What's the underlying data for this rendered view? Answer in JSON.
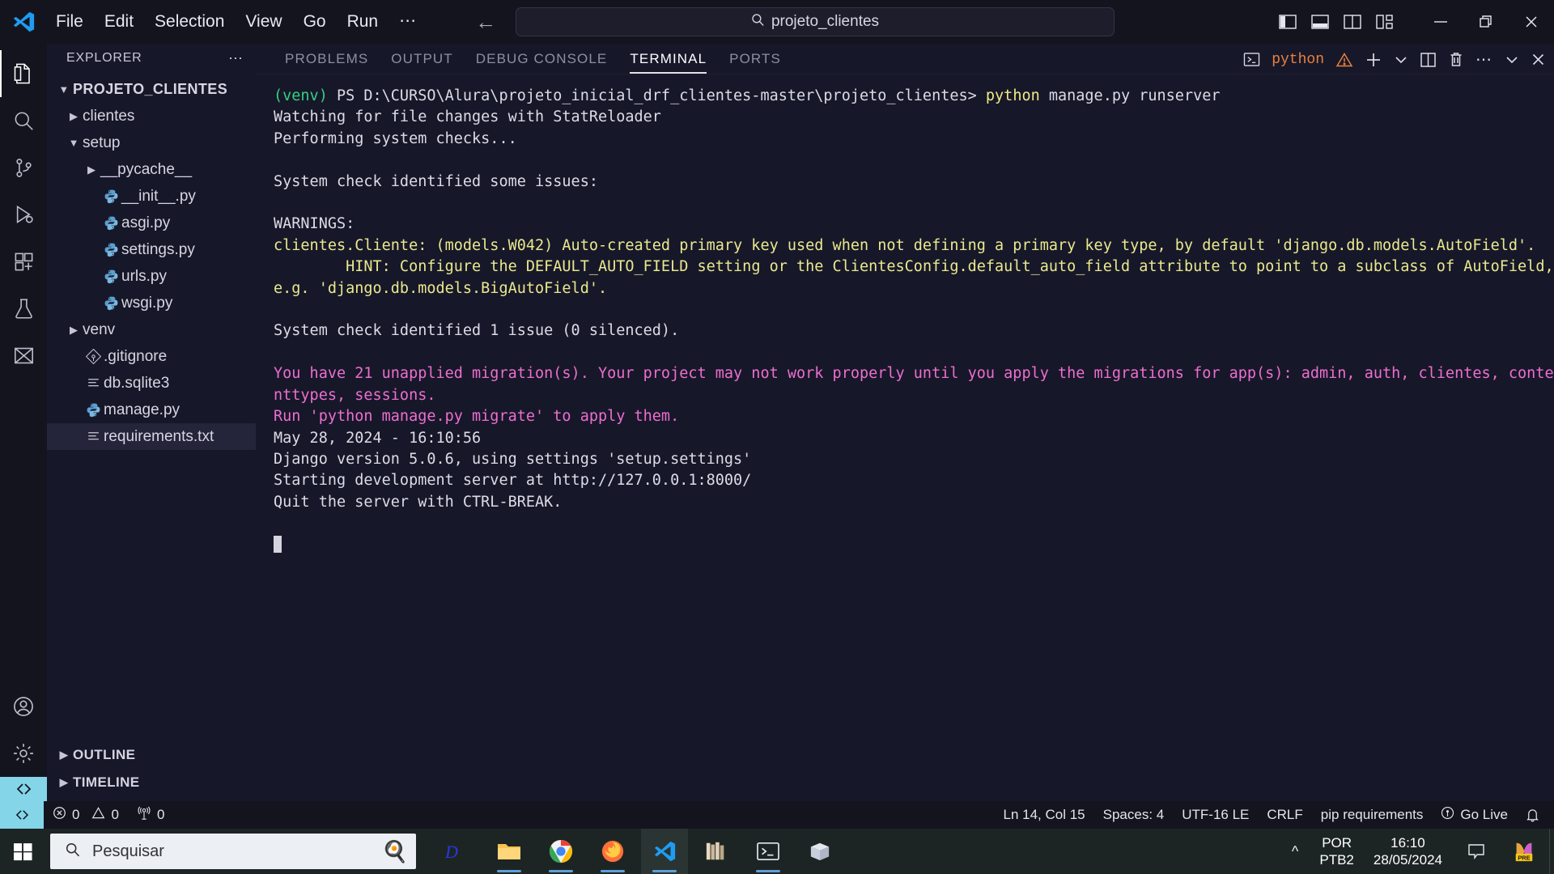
{
  "titlebar": {
    "logo_icon": "vscode-logo-icon",
    "menus": [
      "File",
      "Edit",
      "Selection",
      "View",
      "Go",
      "Run",
      "⋯"
    ],
    "nav": {
      "back_icon": "arrow-left-icon",
      "forward_icon": "arrow-right-icon"
    },
    "search": {
      "icon": "search-icon",
      "value": "projeto_clientes",
      "placeholder": "Search"
    },
    "layout_toggles": [
      "toggle-primary-sidebar-icon",
      "toggle-panel-icon",
      "toggle-secondary-sidebar-icon",
      "customize-layout-icon"
    ],
    "window_controls": {
      "minimize": "minimize-icon",
      "restore": "restore-icon",
      "close": "close-icon"
    }
  },
  "activitybar": {
    "items": [
      {
        "name": "explorer",
        "icon": "files-icon",
        "active": true
      },
      {
        "name": "search",
        "icon": "search-icon",
        "active": false
      },
      {
        "name": "source-control",
        "icon": "source-control-icon",
        "active": false
      },
      {
        "name": "run-and-debug",
        "icon": "run-debug-icon",
        "active": false
      },
      {
        "name": "extensions",
        "icon": "extensions-icon",
        "active": false
      },
      {
        "name": "testing",
        "icon": "beaker-icon",
        "active": false
      },
      {
        "name": "todo",
        "icon": "todo-tree-icon",
        "active": false
      }
    ],
    "bottom": [
      {
        "name": "accounts",
        "icon": "account-icon"
      },
      {
        "name": "manage",
        "icon": "gear-icon"
      }
    ],
    "remote_icon": "remote-window-icon"
  },
  "sidebar": {
    "title": "EXPLORER",
    "more_icon": "more-actions-icon",
    "root": {
      "label": "PROJETO_CLIENTES",
      "expanded": true
    },
    "tree": [
      {
        "label": "clientes",
        "type": "folder",
        "expanded": false,
        "indent": 1,
        "icon": "chevron-right-icon"
      },
      {
        "label": "setup",
        "type": "folder",
        "expanded": true,
        "indent": 1,
        "icon": "chevron-down-icon"
      },
      {
        "label": "__pycache__",
        "type": "folder",
        "expanded": false,
        "indent": 2,
        "icon": "chevron-right-icon"
      },
      {
        "label": "__init__.py",
        "type": "python",
        "indent": 2,
        "icon": "python-file-icon"
      },
      {
        "label": "asgi.py",
        "type": "python",
        "indent": 2,
        "icon": "python-file-icon"
      },
      {
        "label": "settings.py",
        "type": "python",
        "indent": 2,
        "icon": "python-file-icon"
      },
      {
        "label": "urls.py",
        "type": "python",
        "indent": 2,
        "icon": "python-file-icon"
      },
      {
        "label": "wsgi.py",
        "type": "python",
        "indent": 2,
        "icon": "python-file-icon"
      },
      {
        "label": "venv",
        "type": "folder",
        "expanded": false,
        "indent": 1,
        "icon": "chevron-right-icon"
      },
      {
        "label": ".gitignore",
        "type": "git",
        "indent": 1,
        "icon": "git-file-icon"
      },
      {
        "label": "db.sqlite3",
        "type": "text",
        "indent": 1,
        "icon": "text-file-icon"
      },
      {
        "label": "manage.py",
        "type": "python",
        "indent": 1,
        "icon": "python-file-icon"
      },
      {
        "label": "requirements.txt",
        "type": "text",
        "indent": 1,
        "icon": "text-file-icon",
        "selected": true
      }
    ],
    "sections": [
      {
        "label": "OUTLINE",
        "expanded": false,
        "icon": "chevron-right-icon"
      },
      {
        "label": "TIMELINE",
        "expanded": false,
        "icon": "chevron-right-icon"
      }
    ]
  },
  "panel": {
    "tabs": [
      {
        "label": "PROBLEMS",
        "active": false
      },
      {
        "label": "OUTPUT",
        "active": false
      },
      {
        "label": "DEBUG CONSOLE",
        "active": false
      },
      {
        "label": "TERMINAL",
        "active": true
      },
      {
        "label": "PORTS",
        "active": false
      }
    ],
    "actions": {
      "shell_icon": "terminal-icon",
      "shell_label": "python",
      "warning_icon": "warning-triangle-icon",
      "new_terminal_icon": "plus-icon",
      "new_terminal_dropdown_icon": "chevron-down-icon",
      "split_icon": "split-editor-icon",
      "kill_icon": "trash-icon",
      "more_icon": "more-actions-icon",
      "collapse_icon": "chevron-down-icon",
      "close_icon": "close-icon"
    }
  },
  "terminal": {
    "lines": [
      [
        {
          "t": "(venv)",
          "c": "green"
        },
        {
          "t": " PS D:\\CURSO\\Alura\\projeto_inicial_drf_clientes-master\\projeto_clientes> ",
          "c": "white"
        },
        {
          "t": "python",
          "c": "yellowcmd"
        },
        {
          "t": " manage.py runserver",
          "c": "white"
        }
      ],
      [
        {
          "t": "Watching for file changes with StatReloader",
          "c": "white"
        }
      ],
      [
        {
          "t": "Performing system checks...",
          "c": "white"
        }
      ],
      [
        {
          "t": "",
          "c": "white"
        }
      ],
      [
        {
          "t": "System check identified some issues:",
          "c": "white"
        }
      ],
      [
        {
          "t": "",
          "c": "white"
        }
      ],
      [
        {
          "t": "WARNINGS:",
          "c": "white"
        }
      ],
      [
        {
          "t": "clientes.Cliente: (models.W042) Auto-created primary key used when not defining a primary key type, by default 'django.db.models.AutoField'.",
          "c": "warn"
        }
      ],
      [
        {
          "t": "        HINT: Configure the DEFAULT_AUTO_FIELD setting or the ClientesConfig.default_auto_field attribute to point to a subclass of AutoField, e.g. 'django.db.models.BigAutoField'.",
          "c": "warn"
        }
      ],
      [
        {
          "t": "",
          "c": "white"
        }
      ],
      [
        {
          "t": "System check identified 1 issue (0 silenced).",
          "c": "white"
        }
      ],
      [
        {
          "t": "",
          "c": "white"
        }
      ],
      [
        {
          "t": "You have 21 unapplied migration(s). Your project may not work properly until you apply the migrations for app(s): admin, auth, clientes, contenttypes, sessions.",
          "c": "magenta"
        }
      ],
      [
        {
          "t": "Run 'python manage.py migrate' to apply them.",
          "c": "magenta"
        }
      ],
      [
        {
          "t": "May 28, 2024 - 16:10:56",
          "c": "white"
        }
      ],
      [
        {
          "t": "Django version 5.0.6, using settings 'setup.settings'",
          "c": "white"
        }
      ],
      [
        {
          "t": "Starting development server at http://127.0.0.1:8000/",
          "c": "white"
        }
      ],
      [
        {
          "t": "Quit the server with CTRL-BREAK.",
          "c": "white"
        }
      ]
    ],
    "cursor_visible": true
  },
  "statusbar": {
    "remote_icon": "remote-window-icon",
    "errors": {
      "icon": "error-circle-icon",
      "count": "0"
    },
    "warnings": {
      "icon": "warning-triangle-icon",
      "count": "0"
    },
    "ports": {
      "icon": "radio-tower-icon",
      "count": "0"
    },
    "cursor_position": "Ln 14, Col 15",
    "indentation": "Spaces: 4",
    "encoding": "UTF-16 LE",
    "eol": "CRLF",
    "language_mode": "pip requirements",
    "go_live": {
      "icon": "broadcast-icon",
      "label": "Go Live"
    },
    "bell_icon": "bell-icon"
  },
  "taskbar": {
    "start_icon": "windows-start-icon",
    "search": {
      "icon": "search-icon",
      "placeholder": "Pesquisar",
      "value": ""
    },
    "search_art_icon": "cooking-emoji-icon",
    "apps": [
      {
        "name": "disney-plus",
        "icon": "disney-plus-icon",
        "open": false
      },
      {
        "name": "file-explorer",
        "icon": "folder-icon",
        "open": true
      },
      {
        "name": "google-chrome",
        "icon": "chrome-icon",
        "open": true
      },
      {
        "name": "firefox",
        "icon": "firefox-icon",
        "open": true
      },
      {
        "name": "visual-studio-code",
        "icon": "vscode-icon",
        "open": true,
        "active": true
      },
      {
        "name": "library-app",
        "icon": "books-icon",
        "open": false
      },
      {
        "name": "windows-terminal",
        "icon": "terminal-icon",
        "open": true
      },
      {
        "name": "unknown-app",
        "icon": "box-icon",
        "open": false
      }
    ],
    "tray": {
      "expand_icon": "chevron-up-icon",
      "language_line1": "POR",
      "language_line2": "PTB2",
      "time": "16:10",
      "date": "28/05/2024",
      "notifications_icon": "speech-bubble-icon",
      "copilot_icon": "copilot-preview-icon",
      "copilot_badge": "PRE"
    }
  },
  "colors": {
    "titlebar_bg": "#14141f",
    "sidebar_bg": "#17172a",
    "terminal_bg": "#17172a",
    "accent_blue": "#0098ff",
    "remote_teal": "#84d5e8",
    "warn_yellow": "#e9e98d",
    "magenta": "#ec6fcd",
    "green": "#35d17f",
    "python_orange": "#e8823c"
  }
}
